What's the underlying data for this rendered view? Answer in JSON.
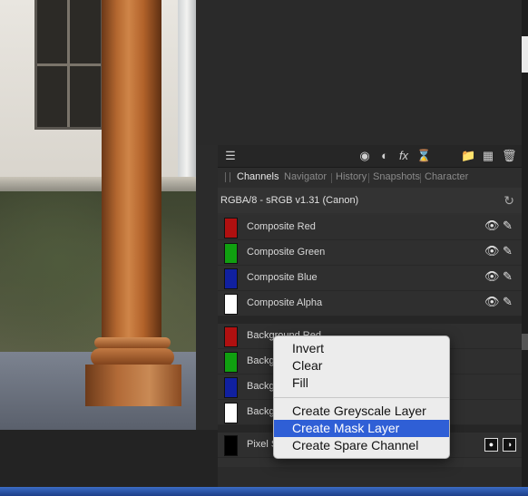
{
  "toolbar": {
    "icons": [
      "layers-icon",
      "mask-icon",
      "adjustment-icon",
      "fx-icon",
      "hourglass-icon",
      "folder-icon",
      "checker-icon",
      "trash-icon"
    ]
  },
  "tabs": [
    {
      "label": "Channels",
      "active": true
    },
    {
      "label": "Navigator",
      "active": false
    },
    {
      "label": "History",
      "active": false
    },
    {
      "label": "Snapshots",
      "active": false
    },
    {
      "label": "Character",
      "active": false
    }
  ],
  "format_label": "RGBA/8 - sRGB v1.31 (Canon)",
  "composite_channels": [
    {
      "name": "Composite Red",
      "color": "#b01010"
    },
    {
      "name": "Composite Green",
      "color": "#10a010"
    },
    {
      "name": "Composite Blue",
      "color": "#1020a0"
    },
    {
      "name": "Composite Alpha",
      "color": "#ffffff"
    }
  ],
  "background_channels": [
    {
      "name": "Background Red",
      "color": "#b01010"
    },
    {
      "name": "Backg",
      "color": "#10a010"
    },
    {
      "name": "Backg",
      "color": "#1020a0"
    },
    {
      "name": "Backg",
      "color": "#ffffff"
    }
  ],
  "pixel_row": {
    "name": "Pixel S",
    "color": "#000000"
  },
  "context_menu": {
    "items": [
      "Invert",
      "Clear",
      "Fill",
      "Create Greyscale Layer",
      "Create Mask Layer",
      "Create Spare Channel"
    ],
    "selected": "Create Mask Layer"
  },
  "colors": {
    "menu_highlight": "#2f5fd6",
    "panel_bg": "#303030"
  }
}
